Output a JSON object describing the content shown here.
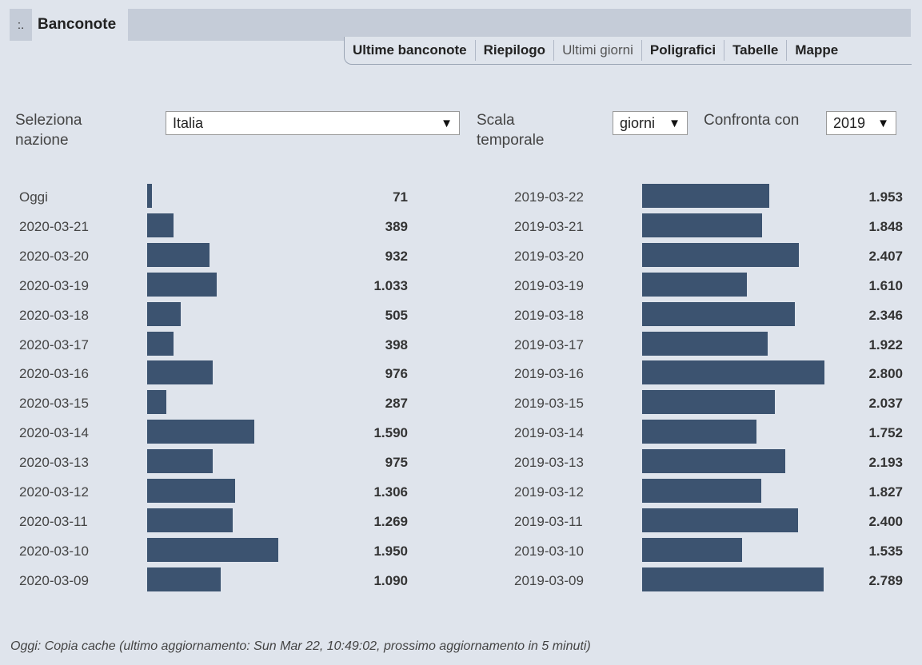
{
  "header": {
    "handle": ":.",
    "title": "Banconote",
    "tabs": [
      {
        "label": "Ultime banconote",
        "style": "bold"
      },
      {
        "label": "Riepilogo",
        "style": "bold"
      },
      {
        "label": "Ultimi giorni",
        "style": "light"
      },
      {
        "label": "Poligrafici",
        "style": "bold"
      },
      {
        "label": "Tabelle",
        "style": "bold"
      },
      {
        "label": "Mappe",
        "style": "bold"
      }
    ]
  },
  "controls": {
    "country_label": "Seleziona nazione",
    "country_value": "Italia",
    "scale_label": "Scala temporale",
    "scale_value": "giorni",
    "compare_label": "Confronta con",
    "compare_value": "2019",
    "caret": "▼"
  },
  "colors": {
    "bar": "#3c5370",
    "background": "#dfe4ec"
  },
  "chart_data": [
    {
      "type": "bar",
      "orientation": "horizontal",
      "categories": [
        "Oggi",
        "2020-03-21",
        "2020-03-20",
        "2020-03-19",
        "2020-03-18",
        "2020-03-17",
        "2020-03-16",
        "2020-03-15",
        "2020-03-14",
        "2020-03-13",
        "2020-03-12",
        "2020-03-11",
        "2020-03-10",
        "2020-03-09"
      ],
      "values": [
        71,
        389,
        932,
        1033,
        505,
        398,
        976,
        287,
        1590,
        975,
        1306,
        1269,
        1950,
        1090
      ],
      "labels": [
        "71",
        "389",
        "932",
        "1.033",
        "505",
        "398",
        "976",
        "287",
        "1.590",
        "975",
        "1.306",
        "1.269",
        "1.950",
        "1.090"
      ]
    },
    {
      "type": "bar",
      "orientation": "horizontal",
      "categories": [
        "2019-03-22",
        "2019-03-21",
        "2019-03-20",
        "2019-03-19",
        "2019-03-18",
        "2019-03-17",
        "2019-03-16",
        "2019-03-15",
        "2019-03-14",
        "2019-03-13",
        "2019-03-12",
        "2019-03-11",
        "2019-03-10",
        "2019-03-09"
      ],
      "values": [
        1953,
        1848,
        2407,
        1610,
        2346,
        1922,
        2800,
        2037,
        1752,
        2193,
        1827,
        2400,
        1535,
        2789
      ],
      "labels": [
        "1.953",
        "1.848",
        "2.407",
        "1.610",
        "2.346",
        "1.922",
        "2.800",
        "2.037",
        "1.752",
        "2.193",
        "1.827",
        "2.400",
        "1.535",
        "2.789"
      ]
    }
  ],
  "footer": {
    "text": "Oggi: Copia cache (ultimo aggiornamento: Sun Mar 22, 10:49:02, prossimo aggiornamento in 5 minuti)"
  }
}
